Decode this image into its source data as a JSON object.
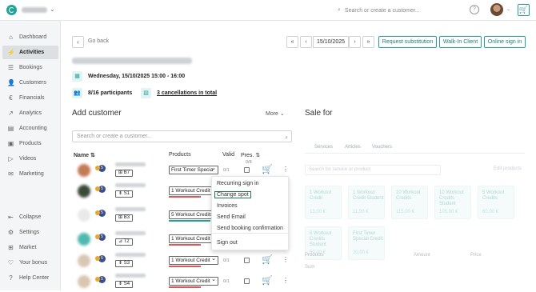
{
  "topbar": {
    "search_placeholder": "Search or create a customer...",
    "help": "?",
    "cart": "🛒"
  },
  "sidebar": {
    "items": [
      {
        "label": "Dashboard",
        "icon": "⌂"
      },
      {
        "label": "Activities",
        "icon": "⚡"
      },
      {
        "label": "Bookings",
        "icon": "☰"
      },
      {
        "label": "Customers",
        "icon": "👤"
      },
      {
        "label": "Financials",
        "icon": "€"
      },
      {
        "label": "Analytics",
        "icon": "↗"
      },
      {
        "label": "Accounting",
        "icon": "▤"
      },
      {
        "label": "Products",
        "icon": "▣"
      },
      {
        "label": "Videos",
        "icon": "▷"
      },
      {
        "label": "Marketing",
        "icon": "✉"
      }
    ],
    "bottom_items": [
      {
        "label": "Collapse",
        "icon": "⇤"
      },
      {
        "label": "Settings",
        "icon": "⚙"
      },
      {
        "label": "Market",
        "icon": "⊞"
      },
      {
        "label": "Your bonus",
        "icon": "♡"
      },
      {
        "label": "Help Center",
        "icon": "?"
      }
    ]
  },
  "header": {
    "back_label": "Go back",
    "back_icon": "‹",
    "first_icon": "«",
    "prev_icon": "‹",
    "date": "15/10/2025",
    "next_icon": "›",
    "last_icon": "»",
    "request_substitution": "Request substitution",
    "walkin": "Walk-In Client",
    "online_signin": "Online sign in"
  },
  "class_info": {
    "datetime": "Wednesday, 15/10/2025 15:00 - 16:00",
    "participants": "8/16 participants",
    "cancellations": "3 cancellations in total",
    "calendar_icon": "▦",
    "people_icon": "👥",
    "cancel_icon": "▧"
  },
  "add_customer": {
    "title": "Add customer",
    "more": "More ⌄",
    "search_placeholder": "Search or create a customer...",
    "search_icon": "⌕",
    "columns": {
      "name": "Name ⇅",
      "products": "Products",
      "valid": "Valid",
      "pres": "Pres. ⇅",
      "pres_count": "0/8"
    },
    "rows": [
      {
        "spot": "⊞ B7",
        "product": "First Timer Specia",
        "valid": "0/1",
        "avatar": "#c47a55",
        "badge": "5",
        "bar": "",
        "show_valid": true,
        "show_check": true
      },
      {
        "spot": "⇟ S1",
        "product": "1 Workout Credit",
        "valid": "",
        "avatar": "#3a4a3a",
        "badge": "5",
        "bar": "#e05555",
        "show_valid": false,
        "show_check": false
      },
      {
        "spot": "⊞ B3",
        "product": "5 Workout Credits",
        "valid": "",
        "avatar": "#e9e9e9",
        "badge": "5",
        "bar": "#22a39a",
        "show_valid": false,
        "show_check": false
      },
      {
        "spot": "⊿ T2",
        "product": "1 Workout Credit",
        "valid": "",
        "avatar": "#4fb8b0",
        "badge": "5",
        "bar": "#e05555",
        "show_valid": false,
        "show_check": false
      },
      {
        "spot": "⇟ S3",
        "product": "1 Workout Credit",
        "valid": "0/1",
        "avatar": "#d9c7b5",
        "badge": "5",
        "bar": "#e05555",
        "show_valid": true,
        "show_check": true
      },
      {
        "spot": "⇟ S4",
        "product": "1 Workout Credit",
        "valid": "0/1",
        "avatar": "#d8c6b0",
        "badge": "5",
        "bar": "#e05555",
        "show_valid": true,
        "show_check": true
      }
    ],
    "cart_icon": "🛒",
    "dots_icon": "⋮"
  },
  "context_menu": {
    "items": [
      "Recurring sign in",
      "Change spot",
      "Invoices",
      "Send Email",
      "Send booking confirmation",
      "Sign out"
    ]
  },
  "sale": {
    "title": "Sale for",
    "tabs": [
      "Services",
      "Articles",
      "Vouchers"
    ],
    "search_placeholder": "Search for service or product",
    "edit_products": "Edit products",
    "cards": [
      {
        "name": "1 Workout Credit",
        "price": "13,00 €"
      },
      {
        "name": "1 Workout Credit Student",
        "price": "11,00 €"
      },
      {
        "name": "10 Workout Credits",
        "price": "115,00 €"
      },
      {
        "name": "10 Workout Credits Student",
        "price": "105,00 €"
      },
      {
        "name": "5 Workout Credits",
        "price": "60,00 €"
      },
      {
        "name": "5 Workout Credits Student",
        "price": "50,00 €"
      },
      {
        "name": "First Timer Special Credit",
        "price": "20,00 €"
      }
    ],
    "summary": {
      "products": "Products",
      "amount": "Amount",
      "price": "Price",
      "sum": "Sum"
    }
  },
  "colors": {
    "accent": "#22a39a",
    "danger": "#e05555"
  }
}
